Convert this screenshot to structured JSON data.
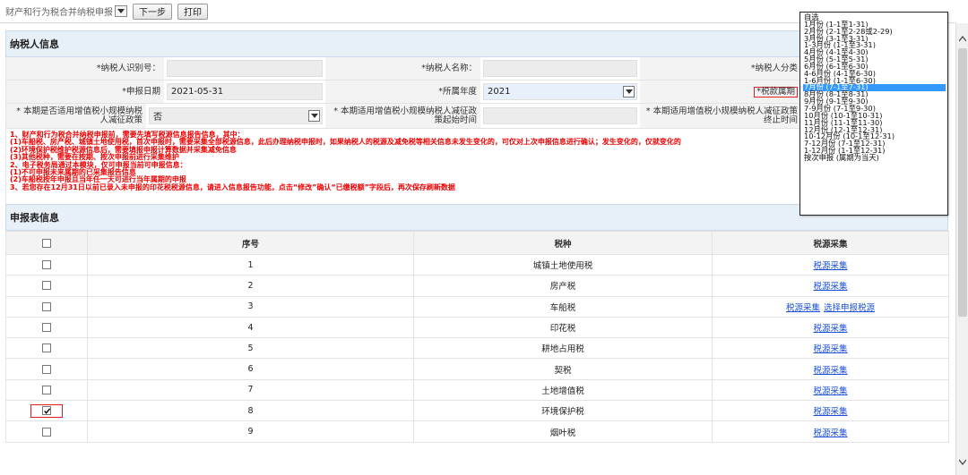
{
  "toolbar": {
    "select_value": "财产和行为税合并纳税申报",
    "next_label": "下一步",
    "print_label": "打印"
  },
  "taxpayer_section": {
    "title": "纳税人信息",
    "id_label": "*纳税人识别号：",
    "name_label": "*纳税人名称：",
    "category_label": "*纳税人分类",
    "date_label": "*申报日期",
    "date_value": "2021-05-31",
    "year_label": "*所属年度",
    "year_value": "2021",
    "period_label": "*税款属期",
    "policy_label": "* 本期是否适用增值税小规模纳税人减征政策",
    "policy_value": "否",
    "policy_start_label": "* 本期适用增值税小规模纳税人减征政策起始时间",
    "policy_end_label": "* 本期适用增值税小规模纳税人减征政策终止时间"
  },
  "notice": [
    "1、财产和行为税合并纳税申报前，需要先填写税源信息报告信息，其中：",
    "(1)车船税、房产税、城镇土地使用税，首次申报时，需要采集全部税源信息，此后办理纳税申报时，如果纳税人的税源及减免税等相关信息未发生变化的，可仅对上次申报信息进行确认；发生变化的，仅就变化的",
    "(2)环境保护税维护税源信息后，需要填报申报计算数据并采集减免信息",
    "(3)其他税种，需要在按期、按次申报前进行采集维护",
    "2、电子税务局通过本模块，仅可申报当前可申报信息：",
    "(1)不可申报未来属期的已采集报告信息",
    "(2)车船税按年申报且当年任一天可进行当年属期的申报",
    "3、若您存在12月31日以前已录入未申报的印花税税源信息，请进入信息报告功能，点击“修改”确认“已缴税额”字段后，再次保存刷新数据"
  ],
  "report_section": {
    "title": "申报表信息",
    "col_seq": "序号",
    "col_tax": "税种",
    "col_source": "税源采集",
    "rows": [
      {
        "seq": "1",
        "tax": "城镇土地使用税",
        "link1": "税源采集",
        "link2": "",
        "checked": false
      },
      {
        "seq": "2",
        "tax": "房产税",
        "link1": "税源采集",
        "link2": "",
        "checked": false
      },
      {
        "seq": "3",
        "tax": "车船税",
        "link1": "税源采集",
        "link2": "选择申报税源",
        "checked": false
      },
      {
        "seq": "4",
        "tax": "印花税",
        "link1": "税源采集",
        "link2": "",
        "checked": false
      },
      {
        "seq": "5",
        "tax": "耕地占用税",
        "link1": "税源采集",
        "link2": "",
        "checked": false
      },
      {
        "seq": "6",
        "tax": "契税",
        "link1": "税源采集",
        "link2": "",
        "checked": false
      },
      {
        "seq": "7",
        "tax": "土地增值税",
        "link1": "税源采集",
        "link2": "",
        "checked": false
      },
      {
        "seq": "8",
        "tax": "环境保护税",
        "link1": "税源采集",
        "link2": "",
        "checked": true
      },
      {
        "seq": "9",
        "tax": "烟叶税",
        "link1": "税源采集",
        "link2": "",
        "checked": false
      }
    ]
  },
  "period_dropdown": {
    "selected_index": 10,
    "options": [
      "自选",
      "1月份 (1-1至1-31)",
      "2月份 (2-1至2-28或2-29)",
      "3月份 (3-1至3-31)",
      "1-3月份 (1-1至3-31)",
      "4月份 (4-1至4-30)",
      "5月份 (5-1至5-31)",
      "6月份 (6-1至6-30)",
      "4-6月份 (4-1至6-30)",
      "1-6月份 (1-1至6-30)",
      "7月份 (7-1至7-31)",
      "8月份 (8-1至8-31)",
      "9月份 (9-1至9-30)",
      "7-9月份 (7-1至9-30)",
      "10月份 (10-1至10-31)",
      "11月份 (11-1至11-30)",
      "12月份 (12-1至12-31)",
      "10-12月份 (10-1至12-31)",
      "7-12月份 (7-1至12-31)",
      "1-12月份 (1-1至12-31)",
      "按次申报 (属期为当天)"
    ]
  }
}
